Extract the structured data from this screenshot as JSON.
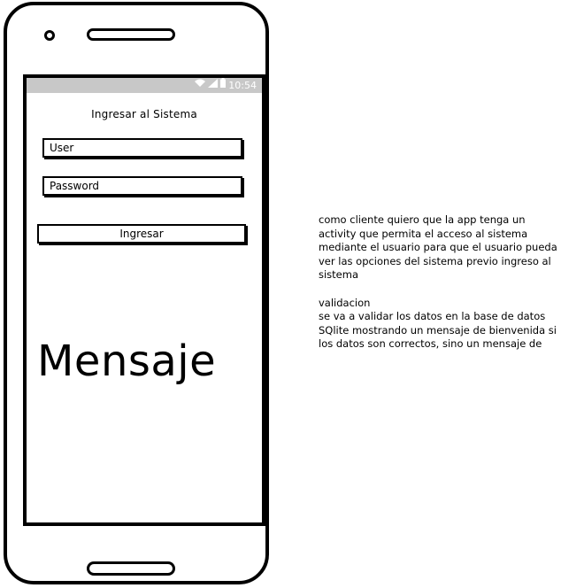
{
  "status_bar": {
    "icons": [
      "wifi-icon",
      "signal-icon",
      "battery-icon"
    ],
    "time": "10:54"
  },
  "login": {
    "title": "Ingresar al Sistema",
    "user_placeholder": "User",
    "password_placeholder": "Password",
    "submit_label": "Ingresar"
  },
  "message_label": "Mensaje",
  "notes": {
    "line1": "como cliente quiero que la app tenga un",
    "line2": "activity que permita el acceso al sistema",
    "line3": "mediante el usuario para que el usuario pueda",
    "line4": "ver las opciones del sistema previo ingreso al",
    "line5": "sistema",
    "line6": "validacion",
    "line7": "se va a validar los datos en la base de datos",
    "line8": "SQlite mostrando un mensaje de bienvenida si",
    "line9": "los datos son correctos, sino un mensaje de"
  },
  "colors": {
    "status_bar_bg": "#c8c8c8",
    "outline": "#000000",
    "background": "#ffffff"
  }
}
